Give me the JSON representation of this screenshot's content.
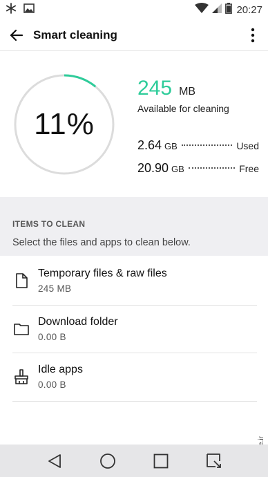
{
  "status_bar": {
    "time": "20:27",
    "icons": [
      "snowflake-icon",
      "image-icon",
      "wifi-icon",
      "signal-icon",
      "battery-icon"
    ]
  },
  "app_bar": {
    "title": "Smart cleaning"
  },
  "summary": {
    "percent_label": "11%",
    "percent_value": 0.11,
    "available_value": "245",
    "available_unit": "MB",
    "available_label": "Available for cleaning",
    "used_value": "2.64",
    "used_unit": "GB",
    "used_label": "Used",
    "free_value": "20.90",
    "free_unit": "GB",
    "free_label": "Free"
  },
  "section": {
    "heading": "ITEMS TO CLEAN",
    "description": "Select the files and apps to clean below."
  },
  "items": [
    {
      "name": "Temporary files & raw files",
      "size": "245  MB",
      "icon": "file-icon"
    },
    {
      "name": "Download folder",
      "size": "0.00  B",
      "icon": "folder-icon"
    },
    {
      "name": "Idle apps",
      "size": "0.00  B",
      "icon": "broom-icon"
    }
  ],
  "watermark": "mobile.ir",
  "colors": {
    "accent": "#2ecc9a",
    "section_bg": "#efeff2",
    "nav_bg": "#e6e6e8"
  }
}
